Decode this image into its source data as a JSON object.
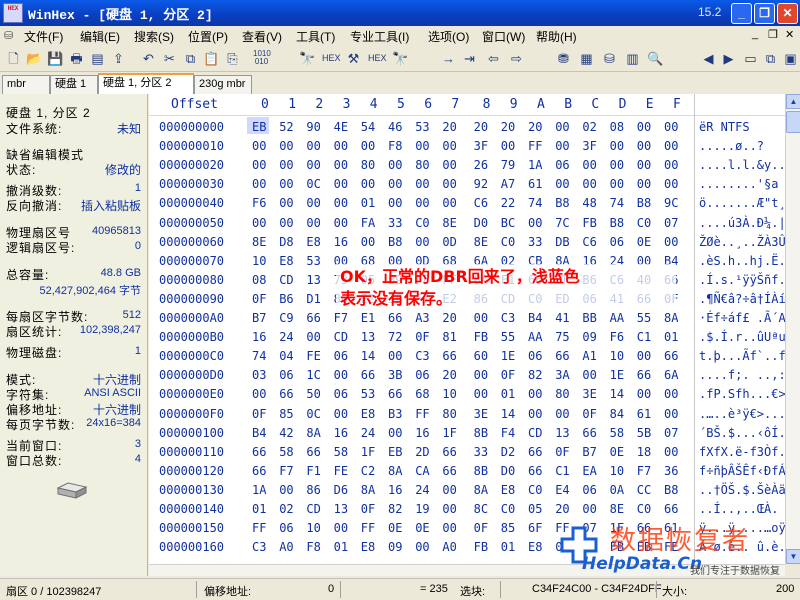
{
  "window": {
    "app_icon_text": "HEX",
    "title": "WinHex - [硬盘 1, 分区 2]",
    "version": "15.2",
    "minimize": "_",
    "maximize": "❐",
    "close": "✕"
  },
  "menu": [
    {
      "label": "文件(F)"
    },
    {
      "label": "编辑(E)"
    },
    {
      "label": "搜索(S)"
    },
    {
      "label": "位置(P)"
    },
    {
      "label": "查看(V)"
    },
    {
      "label": "工具(T)"
    },
    {
      "label": "专业工具(I)"
    },
    {
      "label": "选项(O)"
    },
    {
      "label": "窗口(W)"
    },
    {
      "label": "帮助(H)"
    }
  ],
  "tabs": [
    {
      "label": "mbr"
    },
    {
      "label": "硬盘 1"
    },
    {
      "label": "硬盘 1, 分区 2"
    },
    {
      "label": "230g mbr"
    }
  ],
  "info_panel": {
    "title": "硬盘 1, 分区 2",
    "fs_label": "文件系统:",
    "fs_value": "未知",
    "default_edit_label": "缺省编辑模式",
    "state_label": "状态:",
    "state_value": "修改的",
    "undo_label": "撤消级数:",
    "undo_value": "1",
    "reverse_label": "反向撤消:",
    "reverse_value": "插入粘贴板",
    "phys_sector_label": "物理扇区号",
    "phys_sector_value": "40965813",
    "logical_sector_label": "逻辑扇区号:",
    "logical_sector_value": "0",
    "capacity_label": "总容量:",
    "capacity_value": "48.8 GB",
    "capacity_bytes": "52,427,902,464 字节",
    "bytes_per_sector_label": "每扇区字节数:",
    "bytes_per_sector_value": "512",
    "sector_count_label": "扇区统计:",
    "sector_count_value": "102,398,247",
    "phys_disk_label": "物理磁盘:",
    "phys_disk_value": "1",
    "mode_label": "模式:",
    "mode_value": "十六进制",
    "charset_label": "字符集:",
    "charset_value": "ANSI ASCII",
    "offset_label": "偏移地址:",
    "offset_value": "十六进制",
    "bytes_per_page_label": "每页字节数:",
    "bytes_per_page_value": "24x16=384",
    "cur_window_label": "当前窗口:",
    "cur_window_value": "3",
    "window_total_label": "窗口总数:",
    "window_total_value": "4"
  },
  "hex_header": {
    "offset": "Offset",
    "columns": [
      "0",
      "1",
      "2",
      "3",
      "4",
      "5",
      "6",
      "7",
      "8",
      "9",
      "A",
      "B",
      "C",
      "D",
      "E",
      "F"
    ]
  },
  "hex_rows": [
    {
      "offset": "000000000",
      "bytes": [
        "EB",
        "52",
        "90",
        "4E",
        "54",
        "46",
        "53",
        "20",
        "20",
        "20",
        "20",
        "00",
        "02",
        "08",
        "00",
        "00"
      ],
      "ascii": "ëR NTFS"
    },
    {
      "offset": "000000010",
      "bytes": [
        "00",
        "00",
        "00",
        "00",
        "00",
        "F8",
        "00",
        "00",
        "3F",
        "00",
        "FF",
        "00",
        "3F",
        "00",
        "00",
        "00"
      ],
      "ascii": ".....ø..?"
    },
    {
      "offset": "000000020",
      "bytes": [
        "00",
        "00",
        "00",
        "00",
        "80",
        "00",
        "80",
        "00",
        "26",
        "79",
        "1A",
        "06",
        "00",
        "00",
        "00",
        "00"
      ],
      "ascii": "....l.l.&y.."
    },
    {
      "offset": "000000030",
      "bytes": [
        "00",
        "00",
        "0C",
        "00",
        "00",
        "00",
        "00",
        "00",
        "92",
        "A7",
        "61",
        "00",
        "00",
        "00",
        "00",
        "00"
      ],
      "ascii": "........'§a"
    },
    {
      "offset": "000000040",
      "bytes": [
        "F6",
        "00",
        "00",
        "00",
        "01",
        "00",
        "00",
        "00",
        "C6",
        "22",
        "74",
        "B8",
        "48",
        "74",
        "B8",
        "9C"
      ],
      "ascii": "ö.......Æ\"t¸Ht¸"
    },
    {
      "offset": "000000050",
      "bytes": [
        "00",
        "00",
        "00",
        "00",
        "FA",
        "33",
        "C0",
        "8E",
        "D0",
        "BC",
        "00",
        "7C",
        "FB",
        "B8",
        "C0",
        "07"
      ],
      "ascii": "....ú3À.Ð¼.|û¸À"
    },
    {
      "offset": "000000060",
      "bytes": [
        "8E",
        "D8",
        "E8",
        "16",
        "00",
        "B8",
        "00",
        "0D",
        "8E",
        "C0",
        "33",
        "DB",
        "C6",
        "06",
        "0E",
        "00"
      ],
      "ascii": "ŽØè..¸..ŽÀ3ÛÆ.."
    },
    {
      "offset": "000000070",
      "bytes": [
        "10",
        "E8",
        "53",
        "00",
        "68",
        "00",
        "0D",
        "68",
        "6A",
        "02",
        "CB",
        "8A",
        "16",
        "24",
        "00",
        "B4"
      ],
      "ascii": ".èS.h..hj.Ë.$.´"
    },
    {
      "offset": "000000080",
      "bytes": [
        "08",
        "CD",
        "13",
        "73",
        "05",
        "B9",
        "FF",
        "FF",
        "8A",
        "F1",
        "66",
        "0F",
        "B6",
        "C6",
        "40",
        "66"
      ],
      "ascii": ".Í.s.¹ÿÿŠñf.¶Æ@f"
    },
    {
      "offset": "000000090",
      "bytes": [
        "0F",
        "B6",
        "D1",
        "80",
        "E2",
        "3F",
        "F7",
        "E2",
        "86",
        "CD",
        "C0",
        "ED",
        "06",
        "41",
        "66",
        "0F"
      ],
      "ascii": ".¶Ñ€â?÷â†ÍÀí.Af."
    },
    {
      "offset": "0000000A0",
      "bytes": [
        "B7",
        "C9",
        "66",
        "F7",
        "E1",
        "66",
        "A3",
        "20",
        "00",
        "C3",
        "B4",
        "41",
        "BB",
        "AA",
        "55",
        "8A"
      ],
      "ascii": "·Éf÷áf£ .Ã´A»ªUŠ"
    },
    {
      "offset": "0000000B0",
      "bytes": [
        "16",
        "24",
        "00",
        "CD",
        "13",
        "72",
        "0F",
        "81",
        "FB",
        "55",
        "AA",
        "75",
        "09",
        "F6",
        "C1",
        "01"
      ],
      "ascii": ".$.Í.r..ûUªu.öÁ."
    },
    {
      "offset": "0000000C0",
      "bytes": [
        "74",
        "04",
        "FE",
        "06",
        "14",
        "00",
        "C3",
        "66",
        "60",
        "1E",
        "06",
        "66",
        "A1",
        "10",
        "00",
        "66"
      ],
      "ascii": "t.þ...Ãf`..f¡..f"
    },
    {
      "offset": "0000000D0",
      "bytes": [
        "03",
        "06",
        "1C",
        "00",
        "66",
        "3B",
        "06",
        "20",
        "00",
        "0F",
        "82",
        "3A",
        "00",
        "1E",
        "66",
        "6A"
      ],
      "ascii": "....f;. ..‚:..fj"
    },
    {
      "offset": "0000000E0",
      "bytes": [
        "00",
        "66",
        "50",
        "06",
        "53",
        "66",
        "68",
        "10",
        "00",
        "01",
        "00",
        "80",
        "3E",
        "14",
        "00",
        "00"
      ],
      "ascii": ".fP.Sfh...€>.."
    },
    {
      "offset": "0000000F0",
      "bytes": [
        "0F",
        "85",
        "0C",
        "00",
        "E8",
        "B3",
        "FF",
        "80",
        "3E",
        "14",
        "00",
        "00",
        "0F",
        "84",
        "61",
        "00"
      ],
      "ascii": ".…..è³ÿ€>...„a."
    },
    {
      "offset": "000000100",
      "bytes": [
        "B4",
        "42",
        "8A",
        "16",
        "24",
        "00",
        "16",
        "1F",
        "8B",
        "F4",
        "CD",
        "13",
        "66",
        "58",
        "5B",
        "07"
      ],
      "ascii": "´BŠ.$...‹ôÍ.fX[."
    },
    {
      "offset": "000000110",
      "bytes": [
        "66",
        "58",
        "66",
        "58",
        "1F",
        "EB",
        "2D",
        "66",
        "33",
        "D2",
        "66",
        "0F",
        "B7",
        "0E",
        "18",
        "00"
      ],
      "ascii": "fXfX.ë-f3Òf.·..."
    },
    {
      "offset": "000000120",
      "bytes": [
        "66",
        "F7",
        "F1",
        "FE",
        "C2",
        "8A",
        "CA",
        "66",
        "8B",
        "D0",
        "66",
        "C1",
        "EA",
        "10",
        "F7",
        "36"
      ],
      "ascii": "f÷ñþÂŠÊf‹ÐfÁê.÷6"
    },
    {
      "offset": "000000130",
      "bytes": [
        "1A",
        "00",
        "86",
        "D6",
        "8A",
        "16",
        "24",
        "00",
        "8A",
        "E8",
        "C0",
        "E4",
        "06",
        "0A",
        "CC",
        "B8"
      ],
      "ascii": "..†ÖŠ.$.ŠèÀä..Ì¸"
    },
    {
      "offset": "000000140",
      "bytes": [
        "01",
        "02",
        "CD",
        "13",
        "0F",
        "82",
        "19",
        "00",
        "8C",
        "C0",
        "05",
        "20",
        "00",
        "8E",
        "C0",
        "66"
      ],
      "ascii": "..Í..‚..ŒÀ. .ŽÀf"
    },
    {
      "offset": "000000150",
      "bytes": [
        "FF",
        "06",
        "10",
        "00",
        "FF",
        "0E",
        "0E",
        "00",
        "0F",
        "85",
        "6F",
        "FF",
        "07",
        "1F",
        "66",
        "61"
      ],
      "ascii": "ÿ...ÿ....…oÿ..fa"
    },
    {
      "offset": "000000160",
      "bytes": [
        "C3",
        "A0",
        "F8",
        "01",
        "E8",
        "09",
        "00",
        "A0",
        "FB",
        "01",
        "E8",
        "03",
        "00",
        "FB",
        "EB",
        "FE"
      ],
      "ascii": "Ã ø.è.. û.è..ûëþ"
    }
  ],
  "annotation": {
    "line1": "OK，正常的DBR回来了，浅蓝色",
    "line2": "表示没有保存。"
  },
  "watermark": {
    "big": "数据恢复者",
    "url": "HelpData.Cn",
    "sub": "我们专注于数据恢复"
  },
  "status": {
    "sector": "扇区 0 / 102398247",
    "offset_label": "偏移地址:",
    "offset_value": "0",
    "value": "= 235",
    "block_label": "选块:",
    "block_value": "C34F24C00 - C34F24DFF",
    "size_label": "大小:",
    "size_value": "200"
  },
  "colors": {
    "accent": "#1030a0",
    "titlebar": "#0a3fc0",
    "annotation": "#ff0000",
    "unsaved_highlight": "#d0d8ff"
  }
}
